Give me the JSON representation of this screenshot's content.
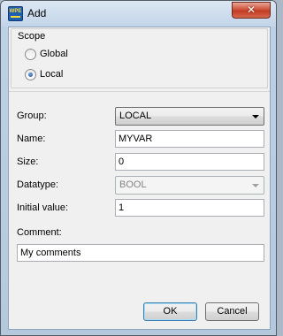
{
  "window": {
    "title": "Add",
    "app_icon_text": "WPE",
    "close_symbol": "✕"
  },
  "scope": {
    "title": "Scope",
    "options": [
      {
        "label": "Global",
        "selected": false
      },
      {
        "label": "Local",
        "selected": true
      }
    ]
  },
  "form": {
    "group": {
      "label": "Group:",
      "value": "LOCAL"
    },
    "name": {
      "label": "Name:",
      "value": "MYVAR"
    },
    "size": {
      "label": "Size:",
      "value": "0"
    },
    "datatype": {
      "label": "Datatype:",
      "value": "BOOL",
      "disabled": true
    },
    "initial_value": {
      "label": "Initial value:",
      "value": "1"
    },
    "comment": {
      "label": "Comment:",
      "value": "My comments"
    }
  },
  "buttons": {
    "ok": "OK",
    "cancel": "Cancel"
  }
}
